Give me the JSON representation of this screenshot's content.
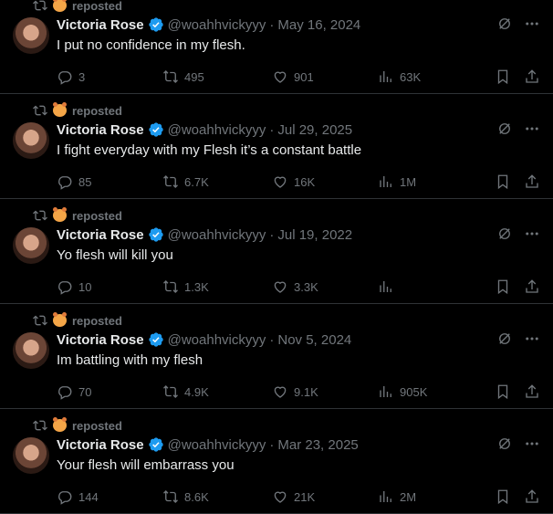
{
  "repost_label": "reposted",
  "author": {
    "name": "Victoria Rose",
    "handle": "@woahhvickyyy"
  },
  "separator": "·",
  "posts": [
    {
      "date": "May 16, 2024",
      "text": "I put no confidence in my flesh.",
      "replies": "3",
      "reposts": "495",
      "likes": "901",
      "views": "63K"
    },
    {
      "date": "Jul 29, 2025",
      "text": "I fight everyday with my Flesh it’s a constant battle",
      "replies": "85",
      "reposts": "6.7K",
      "likes": "16K",
      "views": "1M"
    },
    {
      "date": "Jul 19, 2022",
      "text": "Yo flesh will kill you",
      "replies": "10",
      "reposts": "1.3K",
      "likes": "3.3K",
      "views": ""
    },
    {
      "date": "Nov 5, 2024",
      "text": "Im battling with my flesh",
      "replies": "70",
      "reposts": "4.9K",
      "likes": "9.1K",
      "views": "905K"
    },
    {
      "date": "Mar 23, 2025",
      "text": "Your flesh will embarrass you",
      "replies": "144",
      "reposts": "8.6K",
      "likes": "21K",
      "views": "2M"
    }
  ],
  "colors": {
    "background": "#000000",
    "text": "#e7e9ea",
    "muted": "#71767b",
    "verified": "#1d9bf0",
    "divider": "#2f3336"
  }
}
